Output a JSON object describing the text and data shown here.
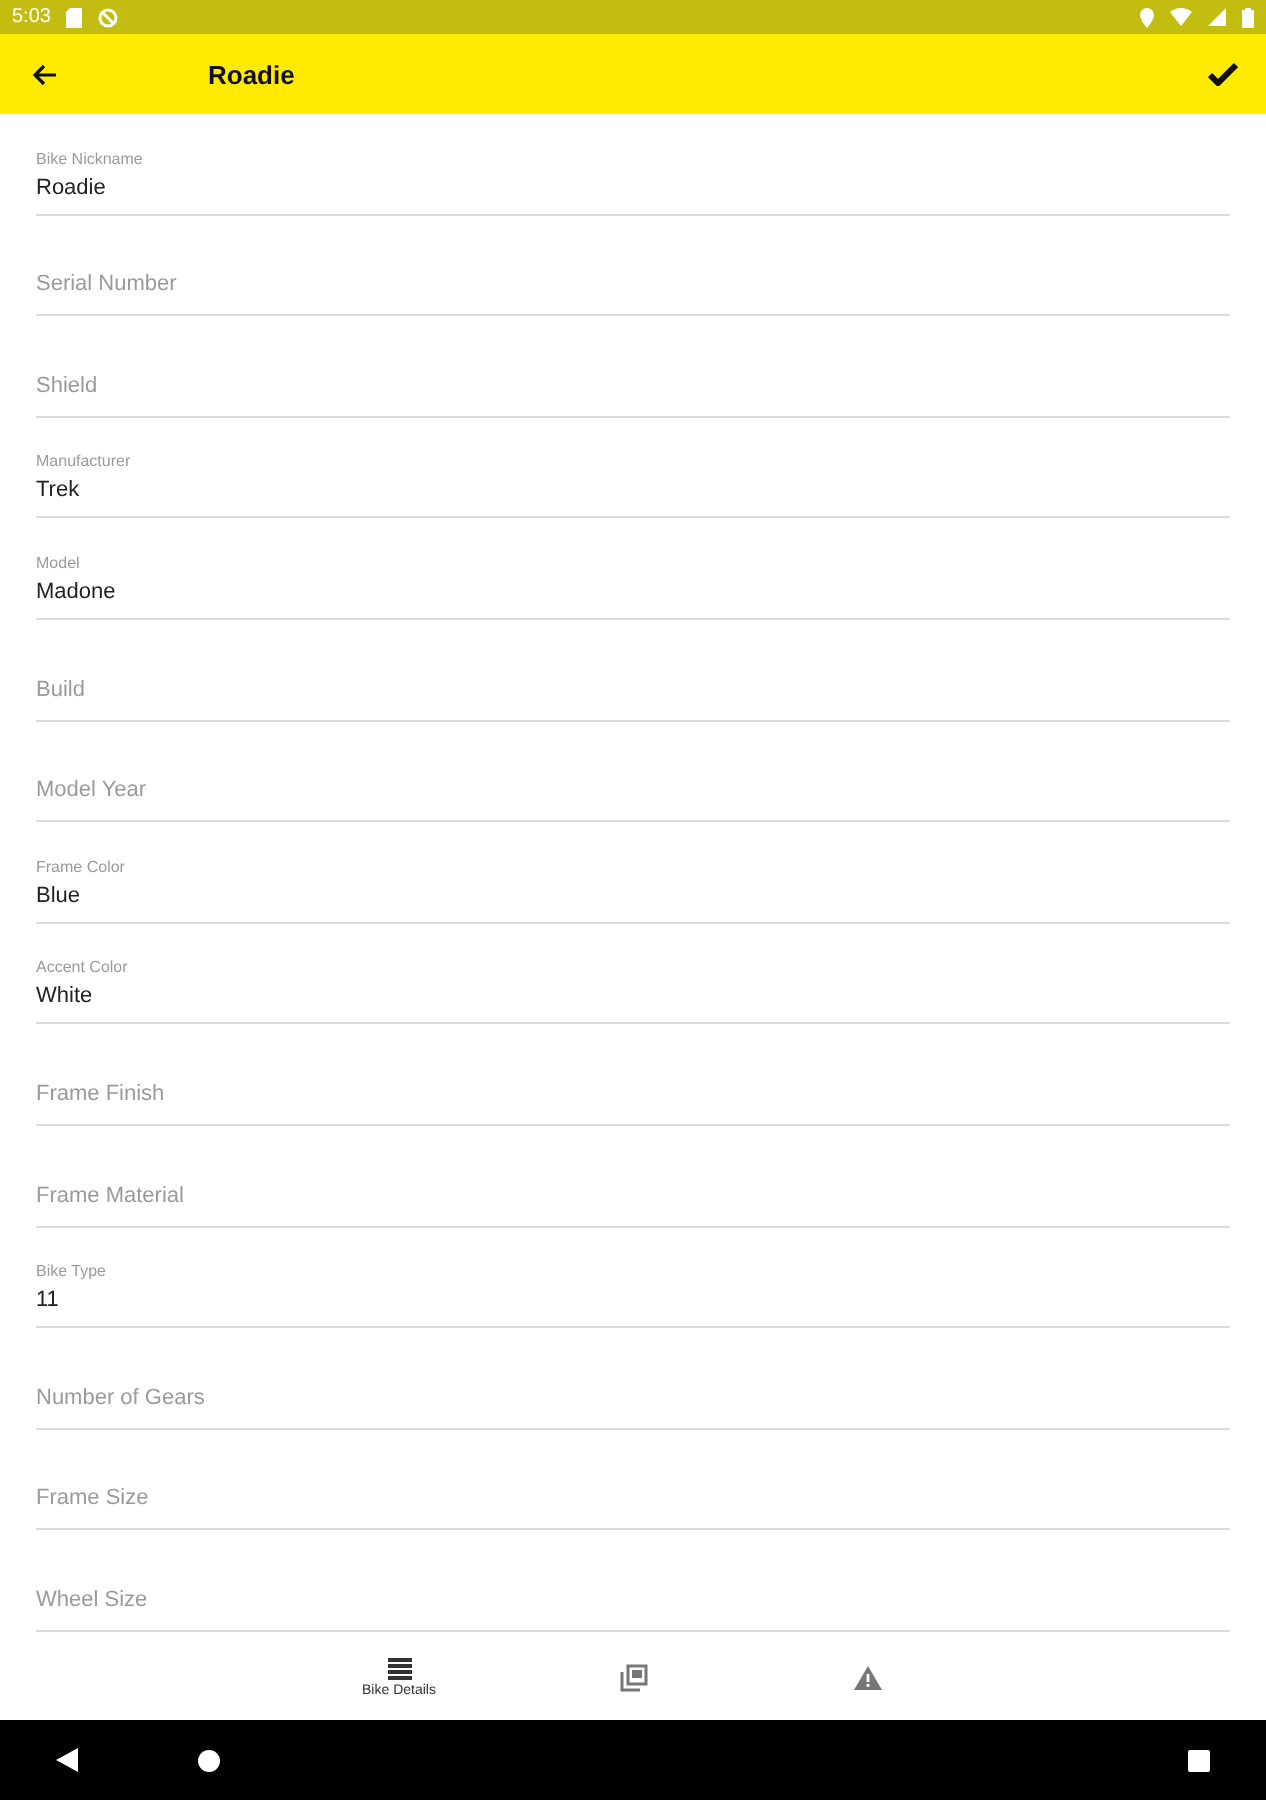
{
  "status_bar": {
    "time": "5:03"
  },
  "toolbar": {
    "title": "Roadie"
  },
  "fields": [
    {
      "label": "Bike Nickname",
      "value": "Roadie"
    },
    {
      "placeholder": "Serial Number"
    },
    {
      "placeholder": "Shield"
    },
    {
      "label": "Manufacturer",
      "value": "Trek"
    },
    {
      "label": "Model",
      "value": "Madone"
    },
    {
      "placeholder": "Build"
    },
    {
      "placeholder": "Model Year"
    },
    {
      "label": "Frame Color",
      "value": "Blue"
    },
    {
      "label": "Accent Color",
      "value": "White"
    },
    {
      "placeholder": "Frame Finish"
    },
    {
      "placeholder": "Frame Material"
    },
    {
      "label": "Bike Type",
      "value": "11"
    },
    {
      "placeholder": "Number of Gears"
    },
    {
      "placeholder": "Frame Size"
    },
    {
      "placeholder": "Wheel Size"
    }
  ],
  "bottom_nav": [
    {
      "label": "Bike Details",
      "selected": true
    },
    {
      "selected": false
    },
    {
      "selected": false
    }
  ]
}
